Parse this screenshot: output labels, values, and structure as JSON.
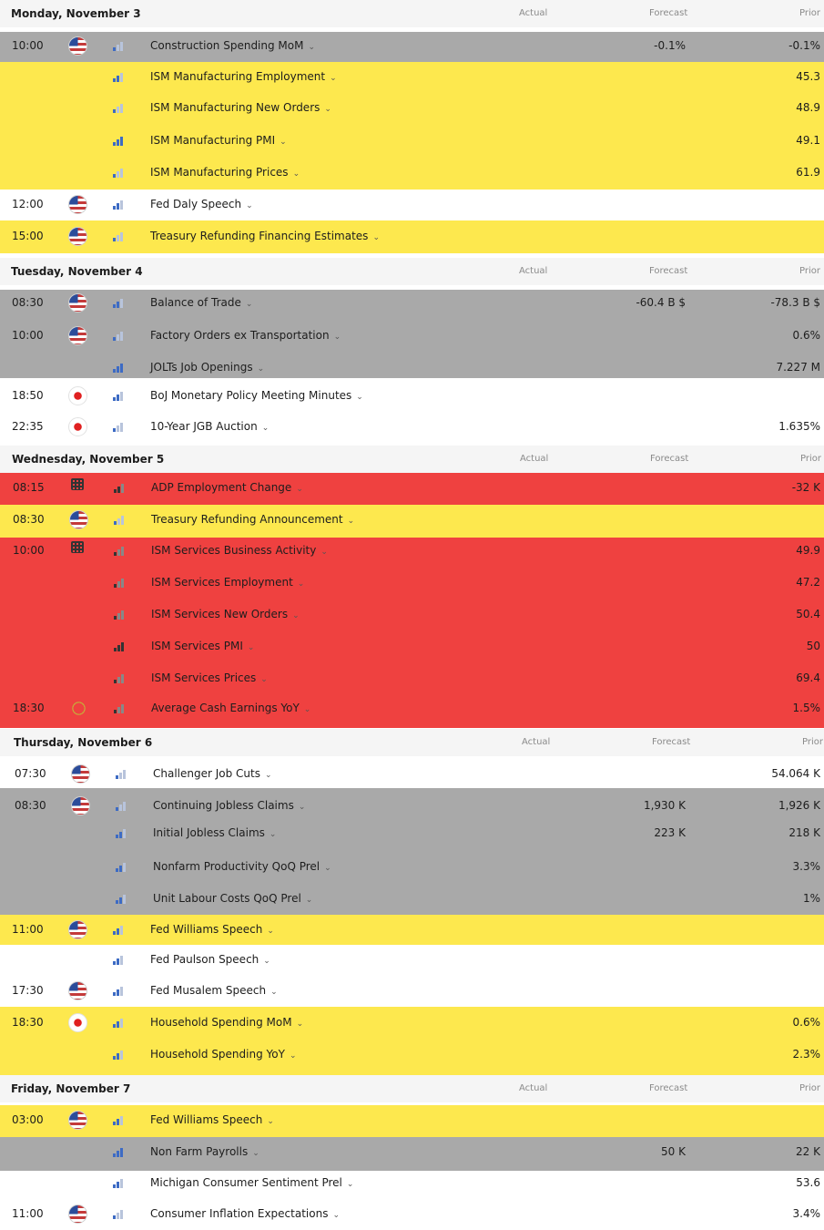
{
  "columns": {
    "actual": "Actual",
    "forecast": "Forecast",
    "prior": "Prior"
  },
  "colors": {
    "yellow": "#fde84e",
    "gray": "#a9a9a9",
    "red": "#ef4140",
    "white": "#ffffff"
  },
  "days": [
    {
      "title": "Monday, November 3"
    },
    {
      "title": "Tuesday, November 4"
    },
    {
      "title": "Wednesday, November 5"
    },
    {
      "title": "Thursday, November 6"
    },
    {
      "title": "Friday, November 7"
    }
  ],
  "events": [
    {
      "time": "10:00",
      "flag": "us-flag-icon",
      "importance": 1,
      "name": "Construction Spending MoM",
      "forecast": "-0.1%",
      "prior": "-0.1%"
    },
    {
      "time": "",
      "flag": "",
      "importance": 2,
      "name": "ISM Manufacturing Employment",
      "forecast": "",
      "prior": "45.3"
    },
    {
      "time": "",
      "flag": "",
      "importance": 1,
      "name": "ISM Manufacturing New Orders",
      "forecast": "",
      "prior": "48.9"
    },
    {
      "time": "",
      "flag": "",
      "importance": 3,
      "name": "ISM Manufacturing PMI",
      "forecast": "",
      "prior": "49.1"
    },
    {
      "time": "",
      "flag": "",
      "importance": 1,
      "name": "ISM Manufacturing Prices",
      "forecast": "",
      "prior": "61.9"
    },
    {
      "time": "12:00",
      "flag": "us-flag-icon",
      "importance": 2,
      "name": "Fed Daly Speech",
      "forecast": "",
      "prior": ""
    },
    {
      "time": "15:00",
      "flag": "us-flag-icon",
      "importance": 1,
      "name": "Treasury Refunding Financing Estimates",
      "forecast": "",
      "prior": ""
    },
    {
      "time": "08:30",
      "flag": "us-flag-icon",
      "importance": 2,
      "name": "Balance of Trade",
      "forecast": "-60.4 B $",
      "prior": "-78.3 B $"
    },
    {
      "time": "10:00",
      "flag": "us-flag-icon",
      "importance": 1,
      "name": "Factory Orders ex Transportation",
      "forecast": "",
      "prior": "0.6%"
    },
    {
      "time": "",
      "flag": "",
      "importance": 3,
      "name": "JOLTs Job Openings",
      "forecast": "",
      "prior": "7.227 M"
    },
    {
      "time": "18:50",
      "flag": "jp-flag-icon",
      "importance": 2,
      "name": "BoJ Monetary Policy Meeting Minutes",
      "forecast": "",
      "prior": ""
    },
    {
      "time": "22:35",
      "flag": "jp-flag-icon",
      "importance": 1,
      "name": "10-Year JGB Auction",
      "forecast": "",
      "prior": "1.635%"
    },
    {
      "time": "08:15",
      "flag": "building-icon",
      "importance": 2,
      "name": "ADP Employment Change",
      "forecast": "",
      "prior": "-32 K"
    },
    {
      "time": "08:30",
      "flag": "us-flag-icon",
      "importance": 1,
      "name": "Treasury Refunding Announcement",
      "forecast": "",
      "prior": ""
    },
    {
      "time": "10:00",
      "flag": "building-icon",
      "importance": 1,
      "name": "ISM Services Business Activity",
      "forecast": "",
      "prior": "49.9"
    },
    {
      "time": "",
      "flag": "",
      "importance": 1,
      "name": "ISM Services Employment",
      "forecast": "",
      "prior": "47.2"
    },
    {
      "time": "",
      "flag": "",
      "importance": 1,
      "name": "ISM Services New Orders",
      "forecast": "",
      "prior": "50.4"
    },
    {
      "time": "",
      "flag": "",
      "importance": 3,
      "name": "ISM Services PMI",
      "forecast": "",
      "prior": "50"
    },
    {
      "time": "",
      "flag": "",
      "importance": 1,
      "name": "ISM Services Prices",
      "forecast": "",
      "prior": "69.4"
    },
    {
      "time": "18:30",
      "flag": "eu-flag-icon",
      "importance": 1,
      "name": "Average Cash Earnings YoY",
      "forecast": "",
      "prior": "1.5%"
    },
    {
      "time": "07:30",
      "flag": "us-flag-icon",
      "importance": 1,
      "name": "Challenger Job Cuts",
      "forecast": "",
      "prior": "54.064 K"
    },
    {
      "time": "08:30",
      "flag": "us-flag-icon",
      "importance": 1,
      "name": "Continuing Jobless Claims",
      "forecast": "1,930 K",
      "prior": "1,926 K"
    },
    {
      "time": "",
      "flag": "",
      "importance": 2,
      "name": "Initial Jobless Claims",
      "forecast": "223 K",
      "prior": "218 K"
    },
    {
      "time": "",
      "flag": "",
      "importance": 2,
      "name": "Nonfarm Productivity QoQ Prel",
      "forecast": "",
      "prior": "3.3%"
    },
    {
      "time": "",
      "flag": "",
      "importance": 2,
      "name": "Unit Labour Costs QoQ Prel",
      "forecast": "",
      "prior": "1%"
    },
    {
      "time": "11:00",
      "flag": "us-flag-icon",
      "importance": 2,
      "name": "Fed Williams Speech",
      "forecast": "",
      "prior": ""
    },
    {
      "time": "",
      "flag": "",
      "importance": 2,
      "name": "Fed Paulson Speech",
      "forecast": "",
      "prior": ""
    },
    {
      "time": "17:30",
      "flag": "us-flag-icon",
      "importance": 2,
      "name": "Fed Musalem Speech",
      "forecast": "",
      "prior": ""
    },
    {
      "time": "18:30",
      "flag": "jp-flag-icon",
      "importance": 2,
      "name": "Household Spending MoM",
      "forecast": "",
      "prior": "0.6%"
    },
    {
      "time": "",
      "flag": "",
      "importance": 2,
      "name": "Household Spending YoY",
      "forecast": "",
      "prior": "2.3%"
    },
    {
      "time": "03:00",
      "flag": "us-flag-icon",
      "importance": 2,
      "name": "Fed Williams Speech",
      "forecast": "",
      "prior": ""
    },
    {
      "time": "",
      "flag": "",
      "importance": 3,
      "name": "Non Farm Payrolls",
      "forecast": "50 K",
      "prior": "22 K"
    },
    {
      "time": "",
      "flag": "",
      "importance": 2,
      "name": "Michigan Consumer Sentiment Prel",
      "forecast": "",
      "prior": "53.6"
    },
    {
      "time": "11:00",
      "flag": "us-flag-icon",
      "importance": 1,
      "name": "Consumer Inflation Expectations",
      "forecast": "",
      "prior": "3.4%"
    }
  ]
}
